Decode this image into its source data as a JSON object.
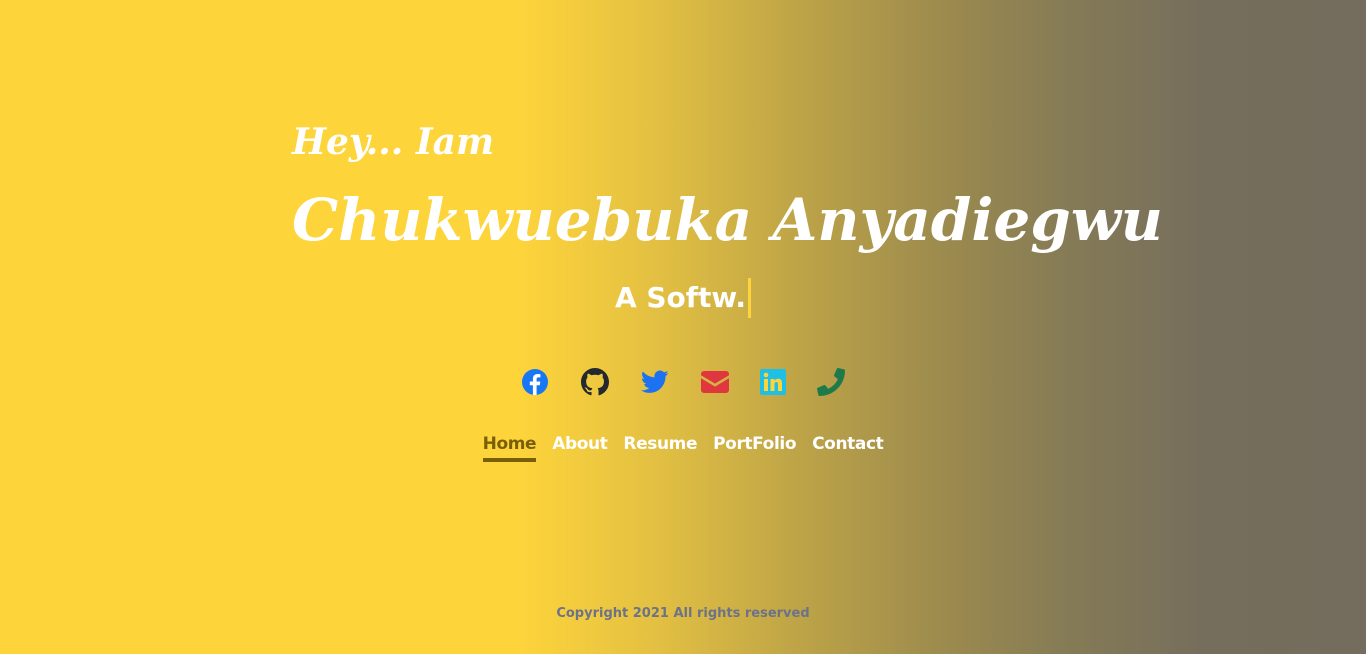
{
  "hero": {
    "greeting": "Hey... Iam",
    "name": "Chukwuebuka Anyadiegwu",
    "typed_text": "A Softw."
  },
  "socials": [
    {
      "icon": "facebook-icon",
      "color": "#1877f2"
    },
    {
      "icon": "github-icon",
      "color": "#24292e"
    },
    {
      "icon": "twitter-icon",
      "color": "#1d72f2"
    },
    {
      "icon": "envelope-icon",
      "color": "#e0363e"
    },
    {
      "icon": "linkedin-icon",
      "color": "#1ec0e6"
    },
    {
      "icon": "phone-icon",
      "color": "#1f7a4a"
    }
  ],
  "nav": {
    "items": [
      {
        "label": "Home",
        "active": true
      },
      {
        "label": "About",
        "active": false
      },
      {
        "label": "Resume",
        "active": false
      },
      {
        "label": "PortFolio",
        "active": false
      },
      {
        "label": "Contact",
        "active": false
      }
    ]
  },
  "footer": {
    "text": "Copyright 2021 All rights reserved"
  },
  "colors": {
    "accent": "#fed43b",
    "active_nav": "#7a5f0a",
    "footer_text": "#6c7288"
  }
}
